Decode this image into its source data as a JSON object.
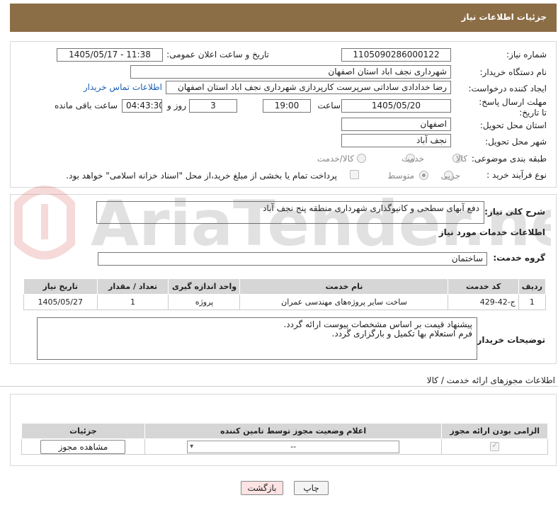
{
  "header": {
    "title": "جزئیات اطلاعات نیاز"
  },
  "form": {
    "need_number_label": "شماره نیاز:",
    "need_number": "1105090286000122",
    "announce_label": "تاریخ و ساعت اعلان عمومی:",
    "announce_value": "1405/05/17 - 11:38",
    "buyer_org_label": "نام دستگاه خریدار:",
    "buyer_org": "شهرداری نجف اباد استان اصفهان",
    "creator_label": "ایجاد کننده درخواست:",
    "creator": "رضا خدادادی ساداتی سرپرست  کارپردازی شهرداری نجف اباد استان اصفهان",
    "buyer_contact_link": "اطلاعات تماس خریدار",
    "deadline_label": "مهلت ارسال پاسخ: تا تاریخ:",
    "deadline_date": "1405/05/20",
    "time_label": "ساعت",
    "deadline_time": "19:00",
    "days_value": "3",
    "days_label": "روز و",
    "remaining_value": "04:43:30",
    "remaining_label": "ساعت باقی مانده",
    "province_label": "استان محل تحویل:",
    "province": "اصفهان",
    "city_label": "شهر محل تحویل:",
    "city": "نجف آباد",
    "category_label": "طبقه بندی موضوعی:",
    "category_options": [
      "کالا",
      "خدمت",
      "کالا/خدمت"
    ],
    "purchase_type_label": "نوع فرآیند خرید :",
    "purchase_type_options": [
      "جزیی",
      "متوسط"
    ],
    "treasury_note": "پرداخت تمام یا بخشی از مبلغ خرید،از محل \"اسناد خزانه اسلامی\" خواهد بود."
  },
  "details": {
    "summary_label": "شرح کلی نیاز:",
    "summary": "دفع آبهای سطحی و کانیوگذاری شهرداری منطقه پنج نجف آباد",
    "services_title": "اطلاعات خدمات مورد نیاز",
    "service_group_label": "گروه خدمت:",
    "service_group": "ساختمان",
    "table": {
      "headers": [
        "ردیف",
        "کد خدمت",
        "نام خدمت",
        "واحد اندازه گیری",
        "تعداد / مقدار",
        "تاریخ نیاز"
      ],
      "rows": [
        [
          "1",
          "ج-42-429",
          "ساخت سایر پروژه‌های مهندسی عمران",
          "پروژه",
          "1",
          "1405/05/27"
        ]
      ]
    },
    "buyer_notes_label": "توضیحات خریدار:",
    "buyer_notes_line1": "پیشنهاد قیمت بر اساس مشخصات پیوست ارائه گردد.",
    "buyer_notes_line2": "فرم استعلام بها تکمیل و بارگزاری گردد."
  },
  "licenses": {
    "title": "اطلاعات مجوزهای ارائه خدمت / کالا",
    "headers": [
      "الزامی بودن ارائه مجوز",
      "اعلام وضعیت مجوز توسط تامین کننده",
      "جزئیات"
    ],
    "select_value": "--",
    "view_button": "مشاهده مجوز"
  },
  "buttons": {
    "print": "چاپ",
    "back": "بازگشت"
  },
  "watermark_text": "AriaTender.net",
  "colors": {
    "header": "#8b6d46",
    "back_button_bg": "#fde3e3",
    "link": "#1a5fb4"
  }
}
